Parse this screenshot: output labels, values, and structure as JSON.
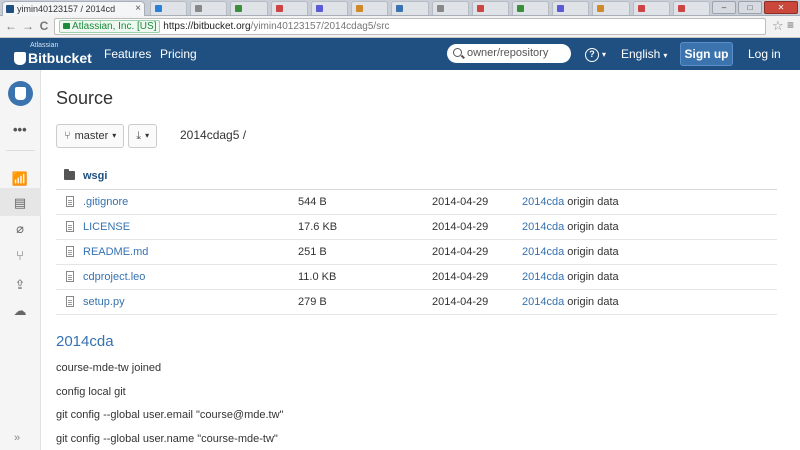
{
  "browser": {
    "tab_title": "yimin40123157 / 2014cd",
    "tab_close": "×",
    "ghost_tab_colors": [
      "#2b7fd6",
      "#888888",
      "#3b8f3b",
      "#c44",
      "#5b5bd6",
      "#d08a2a",
      "#3b73af",
      "#888888",
      "#c44",
      "#3b8f3b",
      "#5b5bd6",
      "#d08a2a",
      "#c44",
      "#c44"
    ],
    "window_controls": [
      "–",
      "□",
      "✕"
    ],
    "back": "←",
    "forward": "→",
    "reload": "C",
    "secure_label": "Atlassian, Inc. [US]",
    "url_host": "https://bitbucket.org",
    "url_path": "/yimin40123157/2014cdag5/src",
    "star": "☆",
    "menu": "≡"
  },
  "header": {
    "logo_small": "Atlassian",
    "logo_main": "Bitbucket",
    "nav": [
      "Features",
      "Pricing"
    ],
    "search_placeholder": "owner/repository",
    "help_icon": "?",
    "caret": "▾",
    "language": "English",
    "signup": "Sign up",
    "login": "Log in",
    "brand_color": "#205081"
  },
  "sidebar": {
    "more": "•••",
    "icons": [
      "stats-icon",
      "source-icon",
      "commits-icon",
      "branches-icon",
      "pull-requests-icon",
      "downloads-icon"
    ],
    "glyphs": [
      "📶",
      "▤",
      "⌀",
      "⑂",
      "⇪",
      "☁"
    ],
    "expand": "»"
  },
  "main": {
    "title": "Source",
    "branch_label": "master",
    "branch_caret": "▾",
    "download_caret": "▾",
    "branch_glyph": "⑂",
    "download_glyph": "⤓",
    "breadcrumb": "2014cdag5 /",
    "directory": "wsgi",
    "files": [
      {
        "name": ".gitignore",
        "size": "544 B",
        "date": "2014-04-29",
        "commit": "2014cda",
        "message": " origin data"
      },
      {
        "name": "LICENSE",
        "size": "17.6 KB",
        "date": "2014-04-29",
        "commit": "2014cda",
        "message": " origin data"
      },
      {
        "name": "README.md",
        "size": "251 B",
        "date": "2014-04-29",
        "commit": "2014cda",
        "message": " origin data"
      },
      {
        "name": "cdproject.leo",
        "size": "11.0 KB",
        "date": "2014-04-29",
        "commit": "2014cda",
        "message": " origin data"
      },
      {
        "name": "setup.py",
        "size": "279 B",
        "date": "2014-04-29",
        "commit": "2014cda",
        "message": " origin data"
      }
    ],
    "readme": {
      "heading": "2014cda",
      "lines": [
        "course-mde-tw joined",
        "config local git",
        "git config --global user.email \"course@mde.tw\"",
        "git config --global user.name \"course-mde-tw\""
      ]
    },
    "link_color": "#3572b0"
  }
}
